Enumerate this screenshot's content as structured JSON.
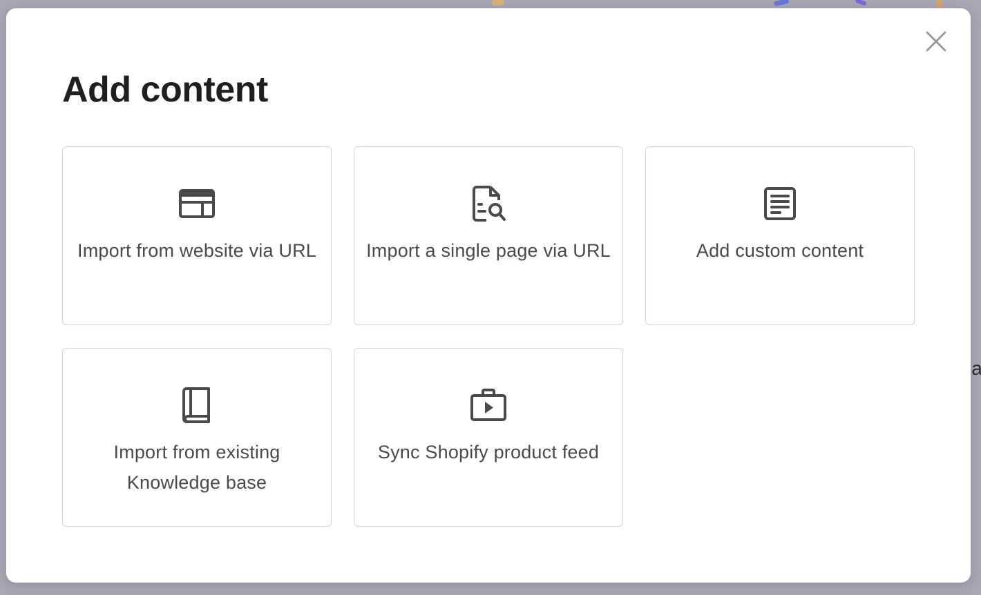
{
  "modal": {
    "title": "Add content",
    "close_icon": "close-icon"
  },
  "options": [
    {
      "label": "Import from website via URL",
      "icon": "website-layout-icon"
    },
    {
      "label": "Import a single page via URL",
      "icon": "document-search-icon"
    },
    {
      "label": "Add custom content",
      "icon": "document-text-icon"
    },
    {
      "label": "Import from existing Knowledge base",
      "icon": "book-icon"
    },
    {
      "label": "Sync Shopify product feed",
      "icon": "shopping-bag-play-icon"
    }
  ],
  "background": {
    "partial_text": "ia"
  },
  "colors": {
    "backdrop": "#a9a7b4",
    "modal_bg": "#ffffff",
    "card_border": "#d6d3e0",
    "icon": "#4a4a4a",
    "title": "#1f1f1f",
    "close_icon": "#9a9a9a"
  }
}
